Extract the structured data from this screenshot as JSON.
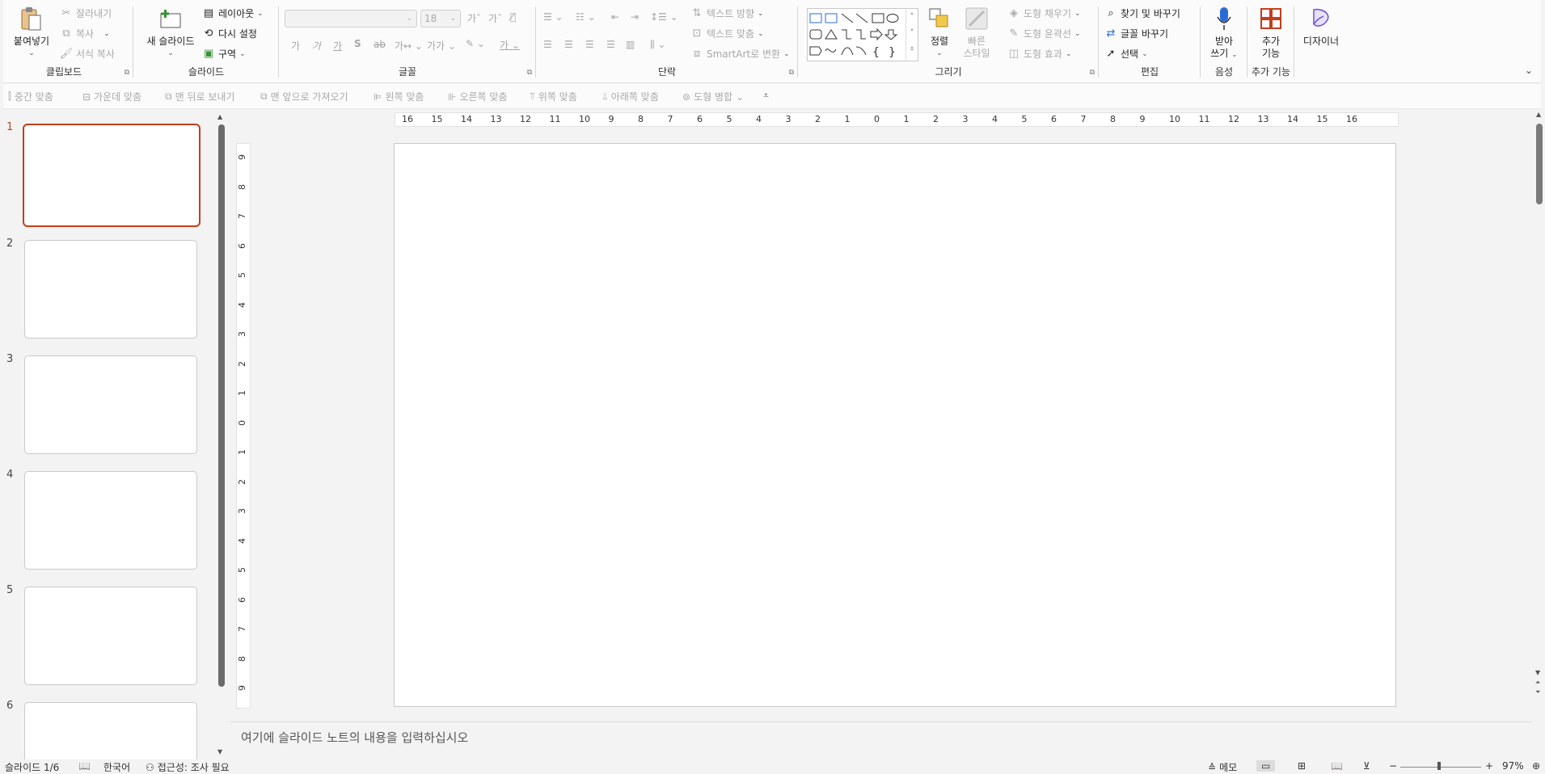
{
  "clipboard": {
    "paste": "붙여넣기",
    "cut": "잘라내기",
    "copy": "복사",
    "format_painter": "서식 복사",
    "title": "클립보드"
  },
  "slides_group": {
    "new_slide": "새 슬라이드",
    "layout": "레이아웃",
    "reset": "다시 설정",
    "section": "구역",
    "title": "슬라이드"
  },
  "font_group": {
    "font_size": "18",
    "title": "글꼴"
  },
  "paragraph_group": {
    "text_direction": "텍스트 방향",
    "align_text": "텍스트 맞춤",
    "smartart": "SmartArt로 변환",
    "title": "단락"
  },
  "drawing_group": {
    "arrange": "정렬",
    "quick_styles_line1": "빠른",
    "quick_styles_line2": "스타일",
    "shape_fill": "도형 채우기",
    "shape_outline": "도형 윤곽선",
    "shape_effects": "도형 효과",
    "title": "그리기"
  },
  "editing_group": {
    "find_replace": "찾기 및 바꾸기",
    "replace_font": "글꼴 바꾸기",
    "select": "선택",
    "title": "편집"
  },
  "voice_group": {
    "dictate_line1": "받아",
    "dictate_line2": "쓰기",
    "title": "음성"
  },
  "addins_group": {
    "addins_line1": "추가",
    "addins_line2": "기능",
    "title": "추가 기능"
  },
  "designer": "디자이너",
  "align_toolbar": {
    "middle": "중간 맞춤",
    "center": "가운데 맞춤",
    "send_back": "맨 뒤로 보내기",
    "bring_front": "맨 앞으로 가져오기",
    "left": "왼쪽 맞춤",
    "right": "오른쪽 맞춤",
    "top": "위쪽 맞춤",
    "bottom": "아래쪽 맞춤",
    "merge_shapes": "도형 병합"
  },
  "thumbnails": [
    {
      "num": "1"
    },
    {
      "num": "2"
    },
    {
      "num": "3"
    },
    {
      "num": "4"
    },
    {
      "num": "5"
    },
    {
      "num": "6"
    }
  ],
  "ruler_h": [
    "16",
    "15",
    "14",
    "13",
    "12",
    "11",
    "10",
    "9",
    "8",
    "7",
    "6",
    "5",
    "4",
    "3",
    "2",
    "1",
    "0",
    "1",
    "2",
    "3",
    "4",
    "5",
    "6",
    "7",
    "8",
    "9",
    "10",
    "11",
    "12",
    "13",
    "14",
    "15",
    "16"
  ],
  "ruler_v": [
    "9",
    "8",
    "7",
    "6",
    "5",
    "4",
    "3",
    "2",
    "1",
    "0",
    "1",
    "2",
    "3",
    "4",
    "5",
    "6",
    "7",
    "8",
    "9"
  ],
  "notes_placeholder": "여기에 슬라이드 노트의 내용을 입력하십시오",
  "status": {
    "slide_counter": "슬라이드 1/6",
    "language": "한국어",
    "accessibility": "접근성: 조사 필요",
    "notes": "메모",
    "zoom": "97%"
  },
  "colors": {
    "accent": "#c43e1c",
    "ribbon_bg": "#fbfbfb",
    "workspace_bg": "#f3f3f3"
  }
}
